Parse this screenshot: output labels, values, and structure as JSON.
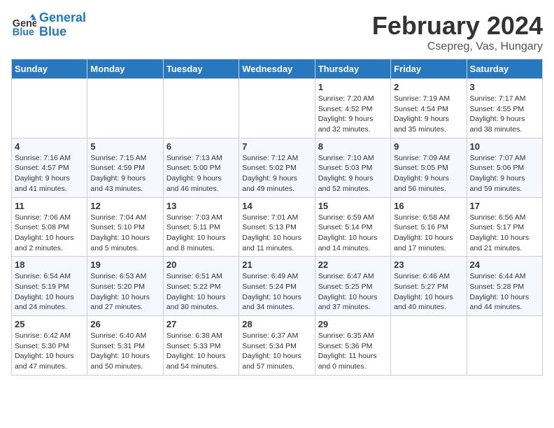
{
  "header": {
    "logo_line1": "General",
    "logo_line2": "Blue",
    "title": "February 2024",
    "subtitle": "Csepreg, Vas, Hungary"
  },
  "calendar": {
    "days_of_week": [
      "Sunday",
      "Monday",
      "Tuesday",
      "Wednesday",
      "Thursday",
      "Friday",
      "Saturday"
    ],
    "weeks": [
      [
        {
          "day": "",
          "info": ""
        },
        {
          "day": "",
          "info": ""
        },
        {
          "day": "",
          "info": ""
        },
        {
          "day": "",
          "info": ""
        },
        {
          "day": "1",
          "info": "Sunrise: 7:20 AM\nSunset: 4:52 PM\nDaylight: 9 hours\nand 32 minutes."
        },
        {
          "day": "2",
          "info": "Sunrise: 7:19 AM\nSunset: 4:54 PM\nDaylight: 9 hours\nand 35 minutes."
        },
        {
          "day": "3",
          "info": "Sunrise: 7:17 AM\nSunset: 4:55 PM\nDaylight: 9 hours\nand 38 minutes."
        }
      ],
      [
        {
          "day": "4",
          "info": "Sunrise: 7:16 AM\nSunset: 4:57 PM\nDaylight: 9 hours\nand 41 minutes."
        },
        {
          "day": "5",
          "info": "Sunrise: 7:15 AM\nSunset: 4:59 PM\nDaylight: 9 hours\nand 43 minutes."
        },
        {
          "day": "6",
          "info": "Sunrise: 7:13 AM\nSunset: 5:00 PM\nDaylight: 9 hours\nand 46 minutes."
        },
        {
          "day": "7",
          "info": "Sunrise: 7:12 AM\nSunset: 5:02 PM\nDaylight: 9 hours\nand 49 minutes."
        },
        {
          "day": "8",
          "info": "Sunrise: 7:10 AM\nSunset: 5:03 PM\nDaylight: 9 hours\nand 52 minutes."
        },
        {
          "day": "9",
          "info": "Sunrise: 7:09 AM\nSunset: 5:05 PM\nDaylight: 9 hours\nand 56 minutes."
        },
        {
          "day": "10",
          "info": "Sunrise: 7:07 AM\nSunset: 5:06 PM\nDaylight: 9 hours\nand 59 minutes."
        }
      ],
      [
        {
          "day": "11",
          "info": "Sunrise: 7:06 AM\nSunset: 5:08 PM\nDaylight: 10 hours\nand 2 minutes."
        },
        {
          "day": "12",
          "info": "Sunrise: 7:04 AM\nSunset: 5:10 PM\nDaylight: 10 hours\nand 5 minutes."
        },
        {
          "day": "13",
          "info": "Sunrise: 7:03 AM\nSunset: 5:11 PM\nDaylight: 10 hours\nand 8 minutes."
        },
        {
          "day": "14",
          "info": "Sunrise: 7:01 AM\nSunset: 5:13 PM\nDaylight: 10 hours\nand 11 minutes."
        },
        {
          "day": "15",
          "info": "Sunrise: 6:59 AM\nSunset: 5:14 PM\nDaylight: 10 hours\nand 14 minutes."
        },
        {
          "day": "16",
          "info": "Sunrise: 6:58 AM\nSunset: 5:16 PM\nDaylight: 10 hours\nand 17 minutes."
        },
        {
          "day": "17",
          "info": "Sunrise: 6:56 AM\nSunset: 5:17 PM\nDaylight: 10 hours\nand 21 minutes."
        }
      ],
      [
        {
          "day": "18",
          "info": "Sunrise: 6:54 AM\nSunset: 5:19 PM\nDaylight: 10 hours\nand 24 minutes."
        },
        {
          "day": "19",
          "info": "Sunrise: 6:53 AM\nSunset: 5:20 PM\nDaylight: 10 hours\nand 27 minutes."
        },
        {
          "day": "20",
          "info": "Sunrise: 6:51 AM\nSunset: 5:22 PM\nDaylight: 10 hours\nand 30 minutes."
        },
        {
          "day": "21",
          "info": "Sunrise: 6:49 AM\nSunset: 5:24 PM\nDaylight: 10 hours\nand 34 minutes."
        },
        {
          "day": "22",
          "info": "Sunrise: 6:47 AM\nSunset: 5:25 PM\nDaylight: 10 hours\nand 37 minutes."
        },
        {
          "day": "23",
          "info": "Sunrise: 6:46 AM\nSunset: 5:27 PM\nDaylight: 10 hours\nand 40 minutes."
        },
        {
          "day": "24",
          "info": "Sunrise: 6:44 AM\nSunset: 5:28 PM\nDaylight: 10 hours\nand 44 minutes."
        }
      ],
      [
        {
          "day": "25",
          "info": "Sunrise: 6:42 AM\nSunset: 5:30 PM\nDaylight: 10 hours\nand 47 minutes."
        },
        {
          "day": "26",
          "info": "Sunrise: 6:40 AM\nSunset: 5:31 PM\nDaylight: 10 hours\nand 50 minutes."
        },
        {
          "day": "27",
          "info": "Sunrise: 6:38 AM\nSunset: 5:33 PM\nDaylight: 10 hours\nand 54 minutes."
        },
        {
          "day": "28",
          "info": "Sunrise: 6:37 AM\nSunset: 5:34 PM\nDaylight: 10 hours\nand 57 minutes."
        },
        {
          "day": "29",
          "info": "Sunrise: 6:35 AM\nSunset: 5:36 PM\nDaylight: 11 hours\nand 0 minutes."
        },
        {
          "day": "",
          "info": ""
        },
        {
          "day": "",
          "info": ""
        }
      ]
    ]
  }
}
